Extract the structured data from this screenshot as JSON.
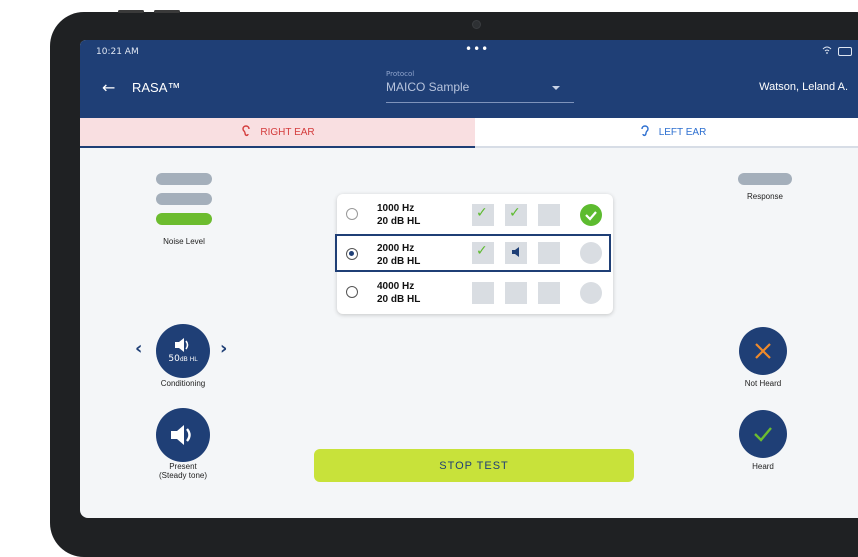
{
  "status": {
    "time": "10:21 AM",
    "dots": "•••"
  },
  "app": {
    "title": "RASA™",
    "back_icon": "arrow-left-icon"
  },
  "protocol": {
    "label": "Protocol",
    "value": "MAICO Sample"
  },
  "patient": "Watson, Leland A.",
  "tabs": {
    "right": "RIGHT EAR",
    "left": "LEFT EAR"
  },
  "noise_level": {
    "label": "Noise Level",
    "level": 1,
    "max": 3
  },
  "response": {
    "label": "Response"
  },
  "frequencies": [
    {
      "hz": "1000 Hz",
      "db": "20 dB HL",
      "selected": false
    },
    {
      "hz": "2000 Hz",
      "db": "20 dB HL",
      "selected": true
    },
    {
      "hz": "4000 Hz",
      "db": "20 dB HL",
      "selected": false
    }
  ],
  "conditioning": {
    "level": "50",
    "unit": "dB HL",
    "label": "Conditioning"
  },
  "present": {
    "label_line1": "Present",
    "label_line2": "(Steady tone)"
  },
  "not_heard": {
    "label": "Not Heard"
  },
  "heard": {
    "label": "Heard"
  },
  "stop_button": "STOP TEST",
  "colors": {
    "primary": "#1f3f76",
    "accent_green": "#5dbb2f",
    "stop_lime": "#c8e23a",
    "not_heard_orange": "#f08a2a",
    "right_ear_red": "#d43c3c",
    "left_ear_blue": "#2d6fd0"
  }
}
